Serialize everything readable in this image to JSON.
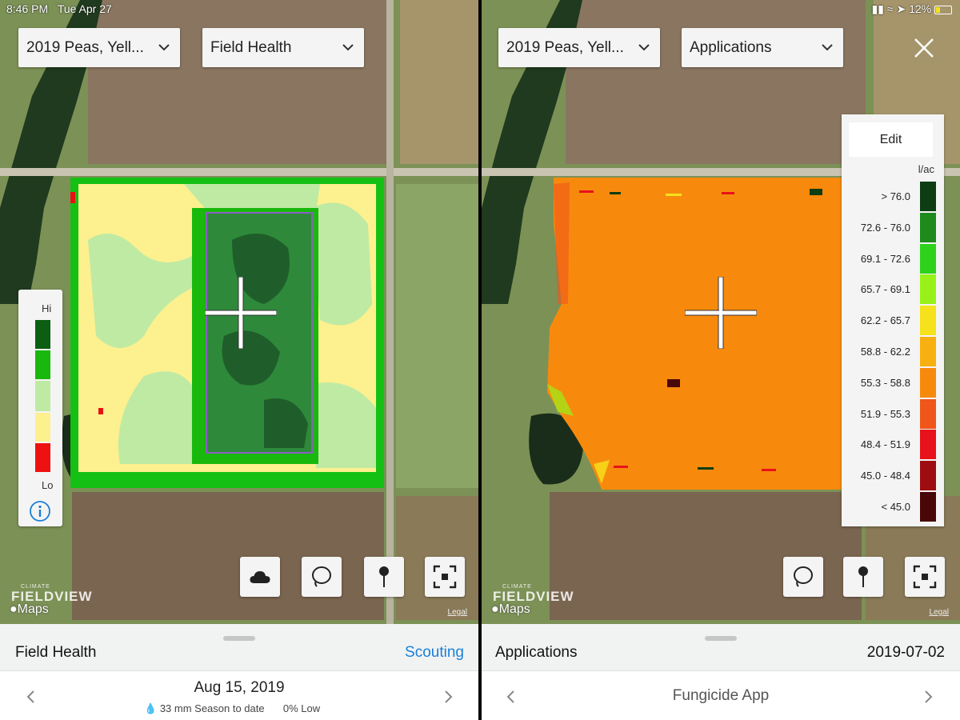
{
  "status": {
    "time": "8:46 PM",
    "date": "Tue Apr 27",
    "battery": "12%"
  },
  "left": {
    "field_dropdown": "2019 Peas, Yell...",
    "layer_dropdown": "Field Health",
    "legend": {
      "hi": "Hi",
      "lo": "Lo",
      "colors": [
        "#0b5e12",
        "#19b80c",
        "#bfeaa3",
        "#fdf08f",
        "#ee1111"
      ]
    },
    "brand_small": "CLIMATE",
    "brand_big": "FIELDVIEW",
    "maps_label": "Maps",
    "legal": "Legal",
    "sheet": {
      "title": "Field Health",
      "action": "Scouting",
      "date": "Aug 15, 2019",
      "rain": "33 mm Season to date",
      "low": "0% Low"
    },
    "icons": [
      "cloud-icon",
      "lasso-icon",
      "pin-icon",
      "frame-icon",
      "info-icon"
    ]
  },
  "right": {
    "field_dropdown": "2019 Peas, Yell...",
    "layer_dropdown": "Applications",
    "legend": {
      "edit": "Edit",
      "unit": "l/ac",
      "rows": [
        {
          "label": "> 76.0",
          "color": "#0d3d12"
        },
        {
          "label": "72.6 - 76.0",
          "color": "#1e8a1c"
        },
        {
          "label": "69.1 - 72.6",
          "color": "#2fd21b"
        },
        {
          "label": "65.7 - 69.1",
          "color": "#98f21a"
        },
        {
          "label": "62.2 - 65.7",
          "color": "#f5e21c"
        },
        {
          "label": "58.8 - 62.2",
          "color": "#f7b00f"
        },
        {
          "label": "55.3 - 58.8",
          "color": "#f78a0d"
        },
        {
          "label": "51.9 - 55.3",
          "color": "#f0561a"
        },
        {
          "label": "48.4 - 51.9",
          "color": "#e8121a"
        },
        {
          "label": "45.0 - 48.4",
          "color": "#9d0d10"
        },
        {
          "label": "< 45.0",
          "color": "#4a0709"
        }
      ]
    },
    "brand_small": "CLIMATE",
    "brand_big": "FIELDVIEW",
    "maps_label": "Maps",
    "legal": "Legal",
    "sheet": {
      "title": "Applications",
      "date": "2019-07-02",
      "product": "Fungicide App"
    }
  }
}
